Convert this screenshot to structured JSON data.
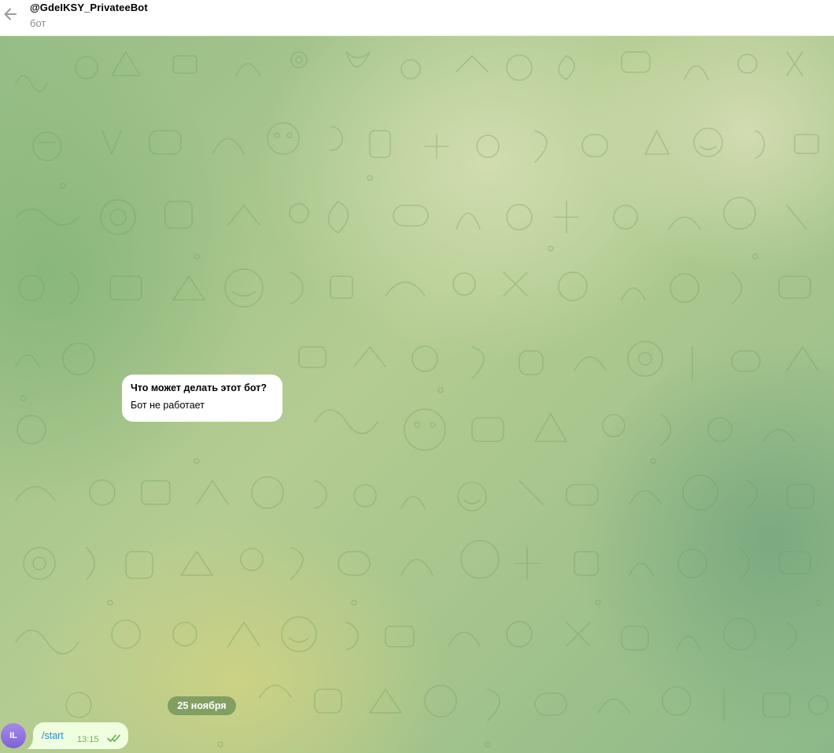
{
  "header": {
    "title": "@GdeIKSY_PrivateeBot",
    "subtitle": "бот",
    "back_icon": "arrow-left-icon"
  },
  "bot_info": {
    "title": "Что может делать этот бот?",
    "description": "Бот не работает"
  },
  "date_separator": "25 ноября",
  "messages": [
    {
      "avatar_initials": "IL",
      "text": "/start",
      "time": "13:15",
      "status_icon": "double-check-icon"
    }
  ],
  "colors": {
    "header_bg": "#ffffff",
    "bubble_out": "#eefedf",
    "bubble_in": "#ffffff",
    "command_text": "#2a8bcc",
    "time_text": "#6fae5c",
    "avatar": "#8b6fe0",
    "date_chip": "#688c54"
  }
}
